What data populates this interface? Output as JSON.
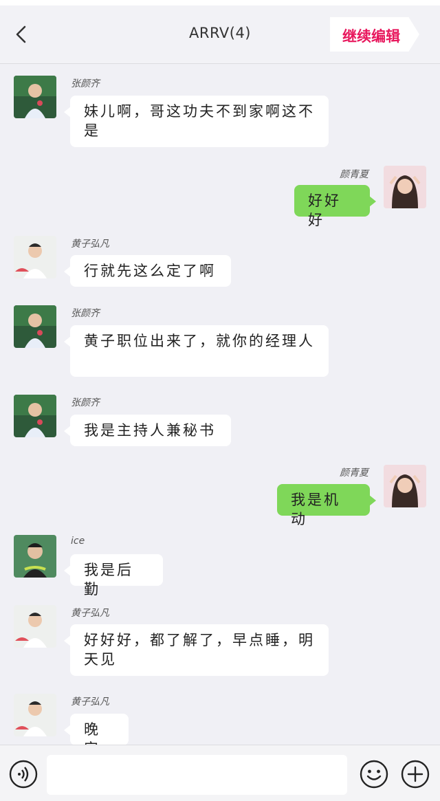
{
  "header": {
    "title": "ARRV(4)",
    "continue_label": "继续编辑",
    "accent_color": "#e8175d"
  },
  "messages": [
    {
      "sender": "张颜齐",
      "side": "left",
      "text": "妹儿啊，哥这功夫不到家啊这不是",
      "avatar": "avatar-zhang"
    },
    {
      "sender": "颜青夏",
      "side": "right",
      "text": "好好好",
      "avatar": "avatar-yan"
    },
    {
      "sender": "黄子弘凡",
      "side": "left",
      "text": "行就先这么定了啊",
      "avatar": "avatar-huang"
    },
    {
      "sender": "张颜齐",
      "side": "left",
      "text": "黄子职位出来了，就你的经理人",
      "avatar": "avatar-zhang"
    },
    {
      "sender": "张颜齐",
      "side": "left",
      "text": "我是主持人兼秘书",
      "avatar": "avatar-zhang"
    },
    {
      "sender": "颜青夏",
      "side": "right",
      "text": "我是机动",
      "avatar": "avatar-yan"
    },
    {
      "sender": "ice",
      "side": "left",
      "text": "我是后勤",
      "avatar": "avatar-ice"
    },
    {
      "sender": "黄子弘凡",
      "side": "left",
      "text": "好好好，都了解了，早点睡，明天见",
      "avatar": "avatar-huang"
    },
    {
      "sender": "黄子弘凡",
      "side": "left",
      "text": "晚安",
      "avatar": "avatar-huang"
    }
  ],
  "input": {
    "value": "",
    "placeholder": ""
  },
  "icons": {
    "back": "chevron-left-icon",
    "voice": "voice-icon",
    "emoji": "emoji-icon",
    "plus": "plus-icon"
  },
  "colors": {
    "my_bubble": "#7fd759",
    "other_bubble": "#ffffff",
    "background": "#f0f0f5"
  }
}
